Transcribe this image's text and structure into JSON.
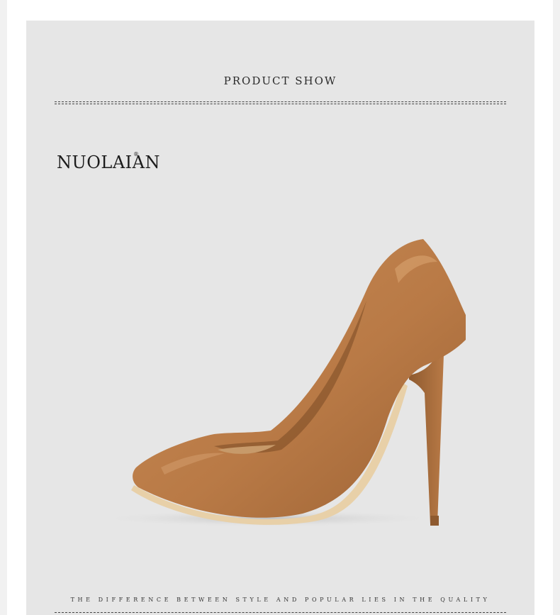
{
  "section": {
    "title": "PRODUCT SHOW"
  },
  "brand": {
    "logo_text": "NUOLAIAN",
    "registered_mark": "®"
  },
  "product": {
    "image_subject": "camel-leather-pointed-stiletto-pump",
    "color": "#b97a46"
  },
  "footer": {
    "tagline": "THE DIFFERENCE BETWEEN STYLE AND POPULAR LIES IN THE QUALITY"
  },
  "colors": {
    "panel_bg": "#e6e6e6",
    "text": "#2b2b2b",
    "shoe_main": "#b97a46",
    "shoe_shadow": "#8e5a2f",
    "sole_edge": "#e8d0a8"
  }
}
